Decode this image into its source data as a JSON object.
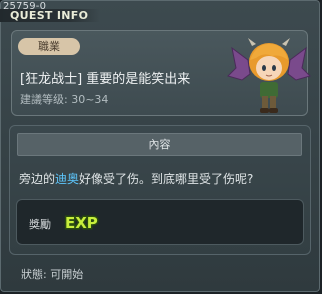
{
  "window": {
    "quest_id": "25759-0",
    "title": "QUEST INFO"
  },
  "quest": {
    "job_badge": "職業",
    "name": "[狂龙战士] 重要的是能笑出来",
    "level_label": "建議等级:",
    "level_range": "30~34"
  },
  "content": {
    "header": "內容",
    "description_prefix": "旁边的",
    "description_highlight": "迪奥",
    "description_suffix": "好像受了伤。到底哪里受了伤呢?",
    "highlight_color": "#5ec8ff"
  },
  "reward": {
    "label": "獎勵",
    "icon": "exp-icon",
    "icon_text": "EXP"
  },
  "status": {
    "label": "狀態:",
    "value": "可開始"
  }
}
